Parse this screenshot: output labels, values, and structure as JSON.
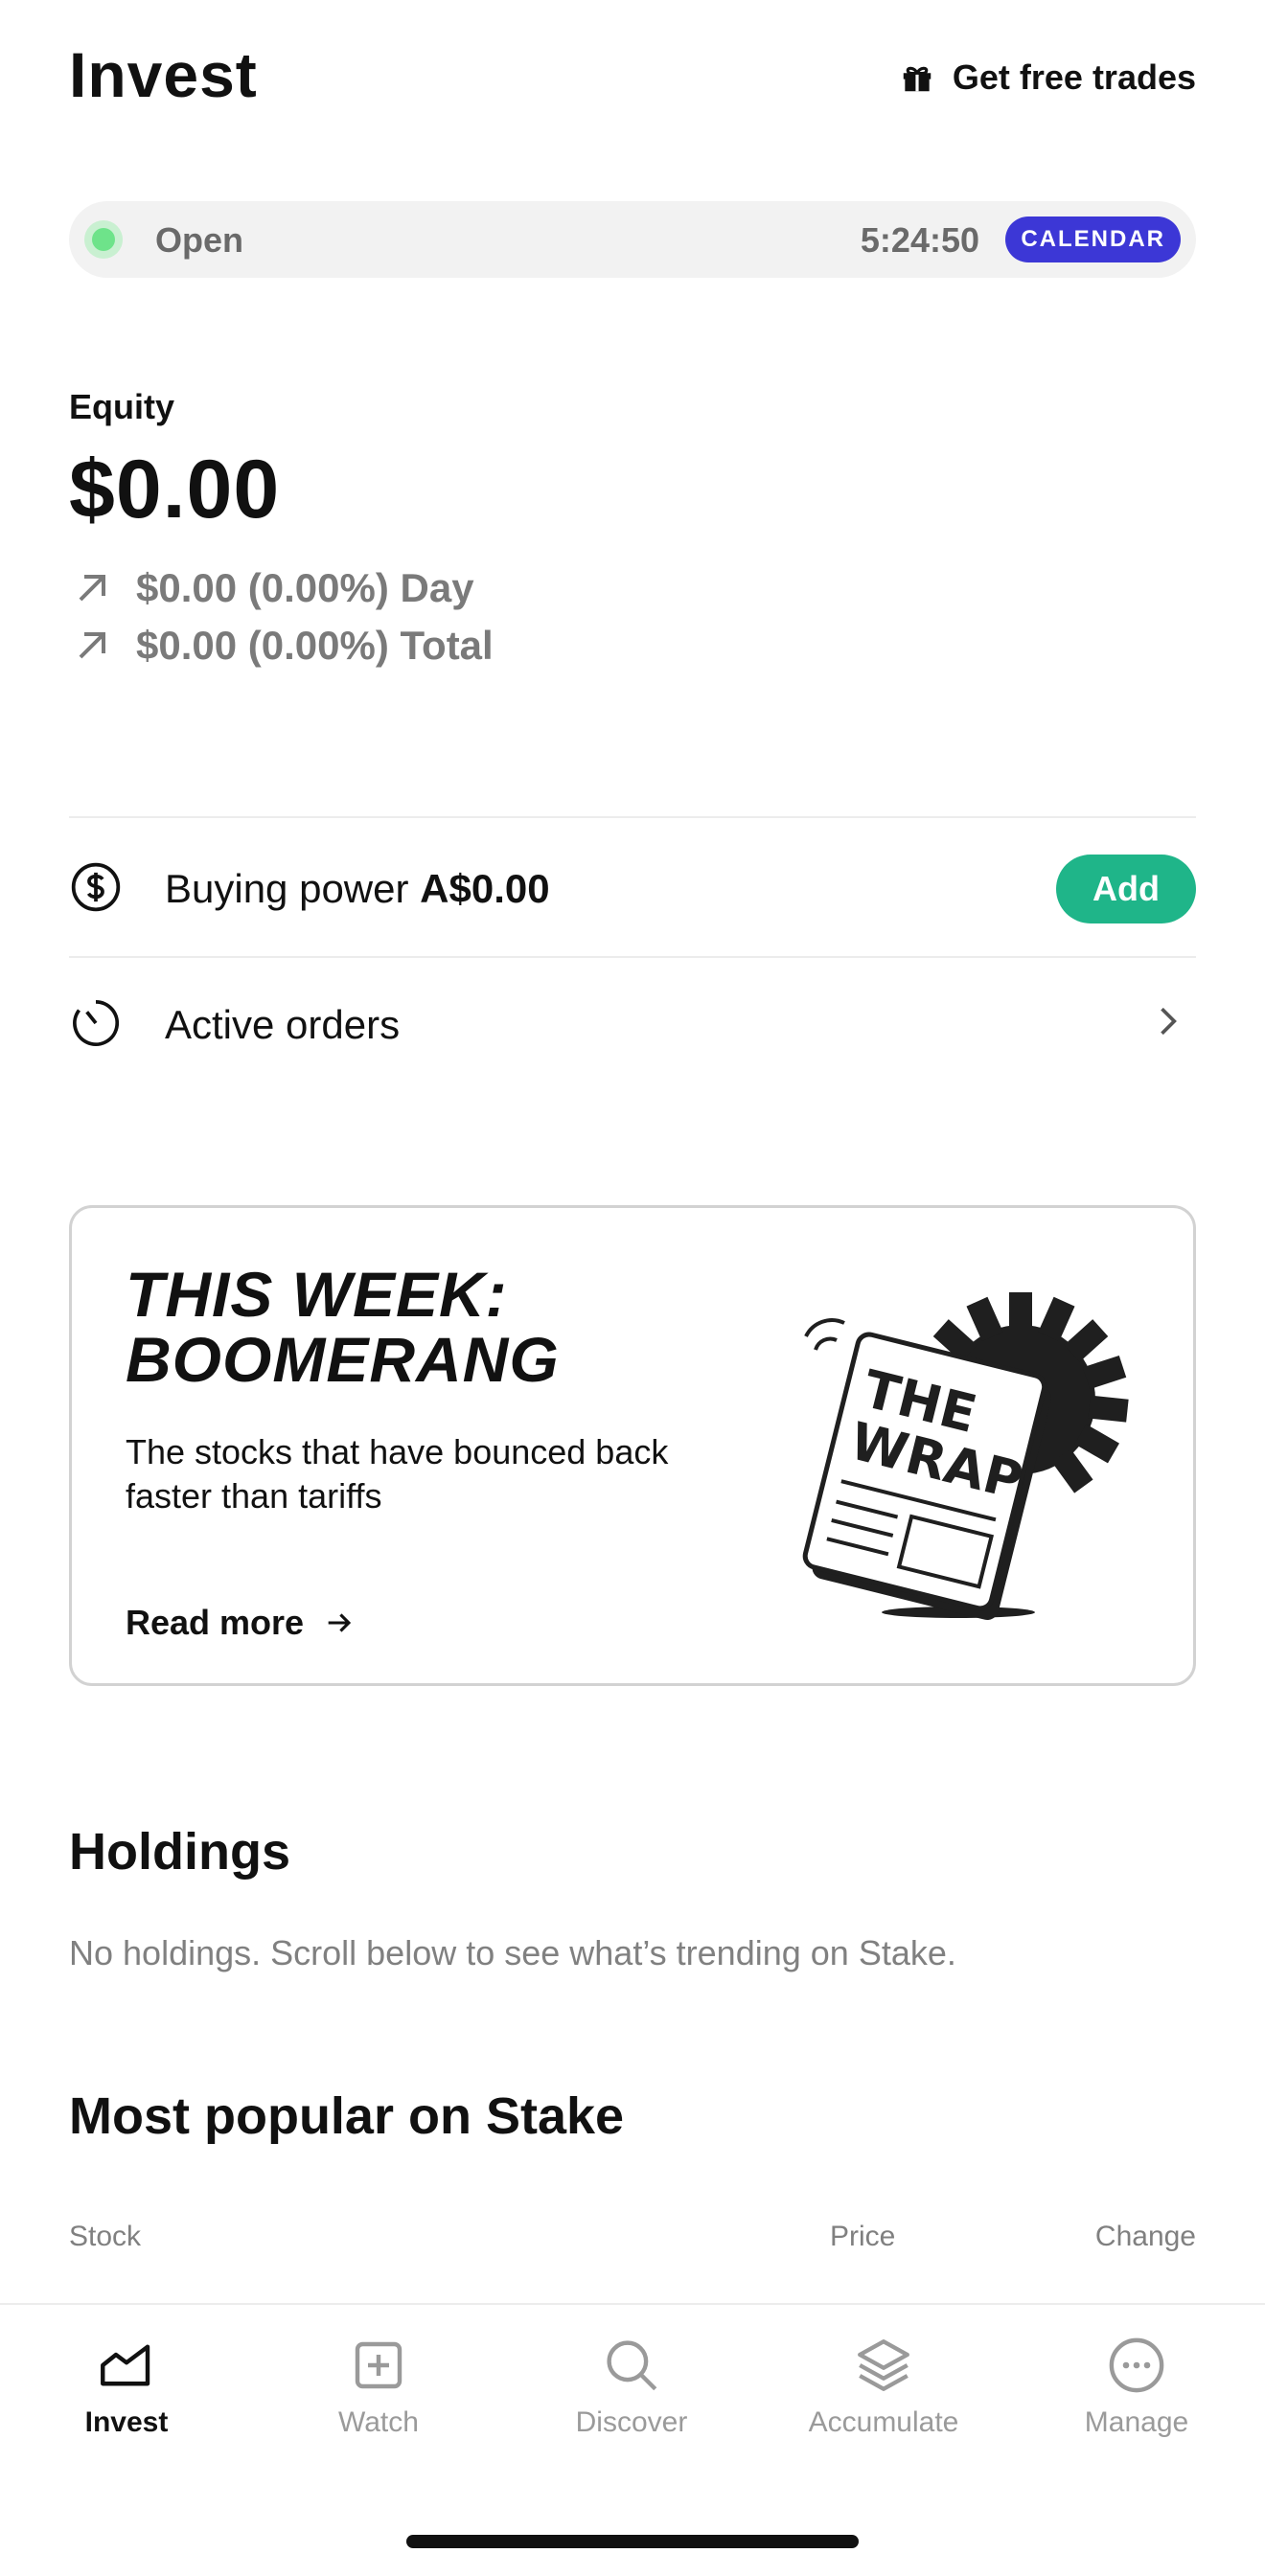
{
  "header": {
    "title": "Invest",
    "free_trades_label": "Get free trades"
  },
  "market": {
    "status": "Open",
    "countdown": "5:24:50",
    "calendar_label": "CALENDAR",
    "status_color": "#6ee38a",
    "calendar_color": "#3c37d6"
  },
  "equity": {
    "label": "Equity",
    "value": "$0.00",
    "day_change": "$0.00 (0.00%) Day",
    "total_change": "$0.00 (0.00%) Total"
  },
  "buying_power": {
    "label": "Buying power",
    "value": "A$0.00",
    "add_label": "Add",
    "add_color": "#1fb589"
  },
  "active_orders": {
    "label": "Active orders"
  },
  "promo": {
    "title": "THIS WEEK:\nBOOMERANG",
    "description": "The stocks that have bounced back faster than tariffs",
    "cta": "Read more",
    "art_text_1": "THE",
    "art_text_2": "WRAP"
  },
  "holdings": {
    "title": "Holdings",
    "empty_text": "No holdings. Scroll below to see what’s trending on Stake."
  },
  "popular": {
    "title": "Most popular on Stake",
    "columns": [
      "Stock",
      "Price",
      "Change"
    ]
  },
  "tabbar": {
    "items": [
      {
        "label": "Invest",
        "icon": "chart-line-icon",
        "active": true
      },
      {
        "label": "Watch",
        "icon": "plus-square-icon",
        "active": false
      },
      {
        "label": "Discover",
        "icon": "search-icon",
        "active": false
      },
      {
        "label": "Accumulate",
        "icon": "layers-icon",
        "active": false
      },
      {
        "label": "Manage",
        "icon": "more-circle-icon",
        "active": false
      }
    ]
  }
}
